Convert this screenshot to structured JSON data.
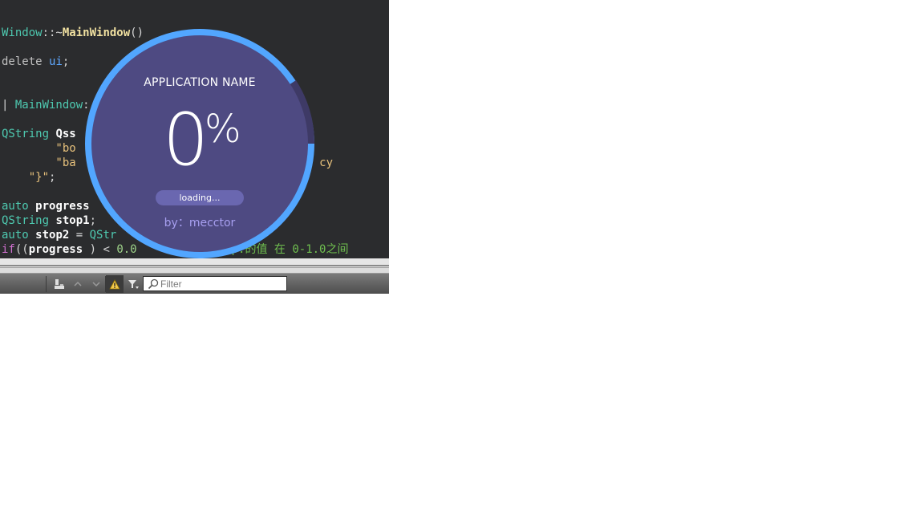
{
  "editor": {
    "lines": [
      [
        {
          "c": "t-cls",
          "t": "Window"
        },
        {
          "c": "t-plain",
          "t": "::~"
        },
        {
          "c": "t-fn",
          "t": "MainWindow"
        },
        {
          "c": "t-plain",
          "t": "()"
        }
      ],
      [
        {
          "c": "t-kw",
          "t": "delete "
        },
        {
          "c": "t-var",
          "t": "ui"
        },
        {
          "c": "t-plain",
          "t": ";"
        }
      ],
      [
        {
          "c": "t-plain",
          "t": "| "
        },
        {
          "c": "t-cls",
          "t": "MainWindow"
        },
        {
          "c": "t-plain",
          "t": ":"
        }
      ],
      [
        {
          "c": "t-cls",
          "t": "QString "
        },
        {
          "c": "t-id",
          "t": "Qss"
        }
      ],
      [
        {
          "c": "t-str",
          "t": "        \"bo"
        }
      ],
      [
        {
          "c": "t-str",
          "t": "        \"ba"
        },
        {
          "c": "t-plain",
          "t": "                            "
        },
        {
          "c": "t-str",
          "t": "cx:0.5, cy"
        }
      ],
      [
        {
          "c": "t-str",
          "t": "    \"}\""
        },
        {
          "c": "t-plain",
          "t": ";"
        }
      ],
      [
        {
          "c": "t-cls",
          "t": "auto "
        },
        {
          "c": "t-id",
          "t": "progress"
        }
      ],
      [
        {
          "c": "t-cls",
          "t": "QString "
        },
        {
          "c": "t-id",
          "t": "stop1"
        },
        {
          "c": "t-plain",
          "t": ";"
        }
      ],
      [
        {
          "c": "t-cls",
          "t": "auto "
        },
        {
          "c": "t-id",
          "t": "stop2"
        },
        {
          "c": "t-plain",
          "t": " = "
        },
        {
          "c": "t-cls",
          "t": "QStr"
        },
        {
          "c": "t-plain",
          "t": "                   ;"
        }
      ],
      [
        {
          "c": "t-ctrl",
          "t": "if"
        },
        {
          "c": "t-plain",
          "t": "(("
        },
        {
          "c": "t-id",
          "t": "progress"
        },
        {
          "c": "t-plain",
          "t": " ) < "
        },
        {
          "c": "t-num",
          "t": "0.0"
        },
        {
          "c": "t-plain",
          "t": "            "
        },
        {
          "c": "t-cmt",
          "t": "top:的值 在 0-1.0之间"
        }
      ]
    ]
  },
  "toolbar": {
    "filter_placeholder": "Filter",
    "icons": [
      "build-icon",
      "up-arrow-icon",
      "down-arrow-icon",
      "warning-icon",
      "filter-funnel-icon",
      "search-icon"
    ]
  },
  "loader": {
    "app_name": "APPLICATION NAME",
    "percent_value": "0",
    "percent_sign": "%",
    "loading_label": "loading...",
    "author": "by：mecctor",
    "colors": {
      "disc": "#4e4a82",
      "ring": "#52a6ff",
      "track": "#3e3a66"
    }
  }
}
